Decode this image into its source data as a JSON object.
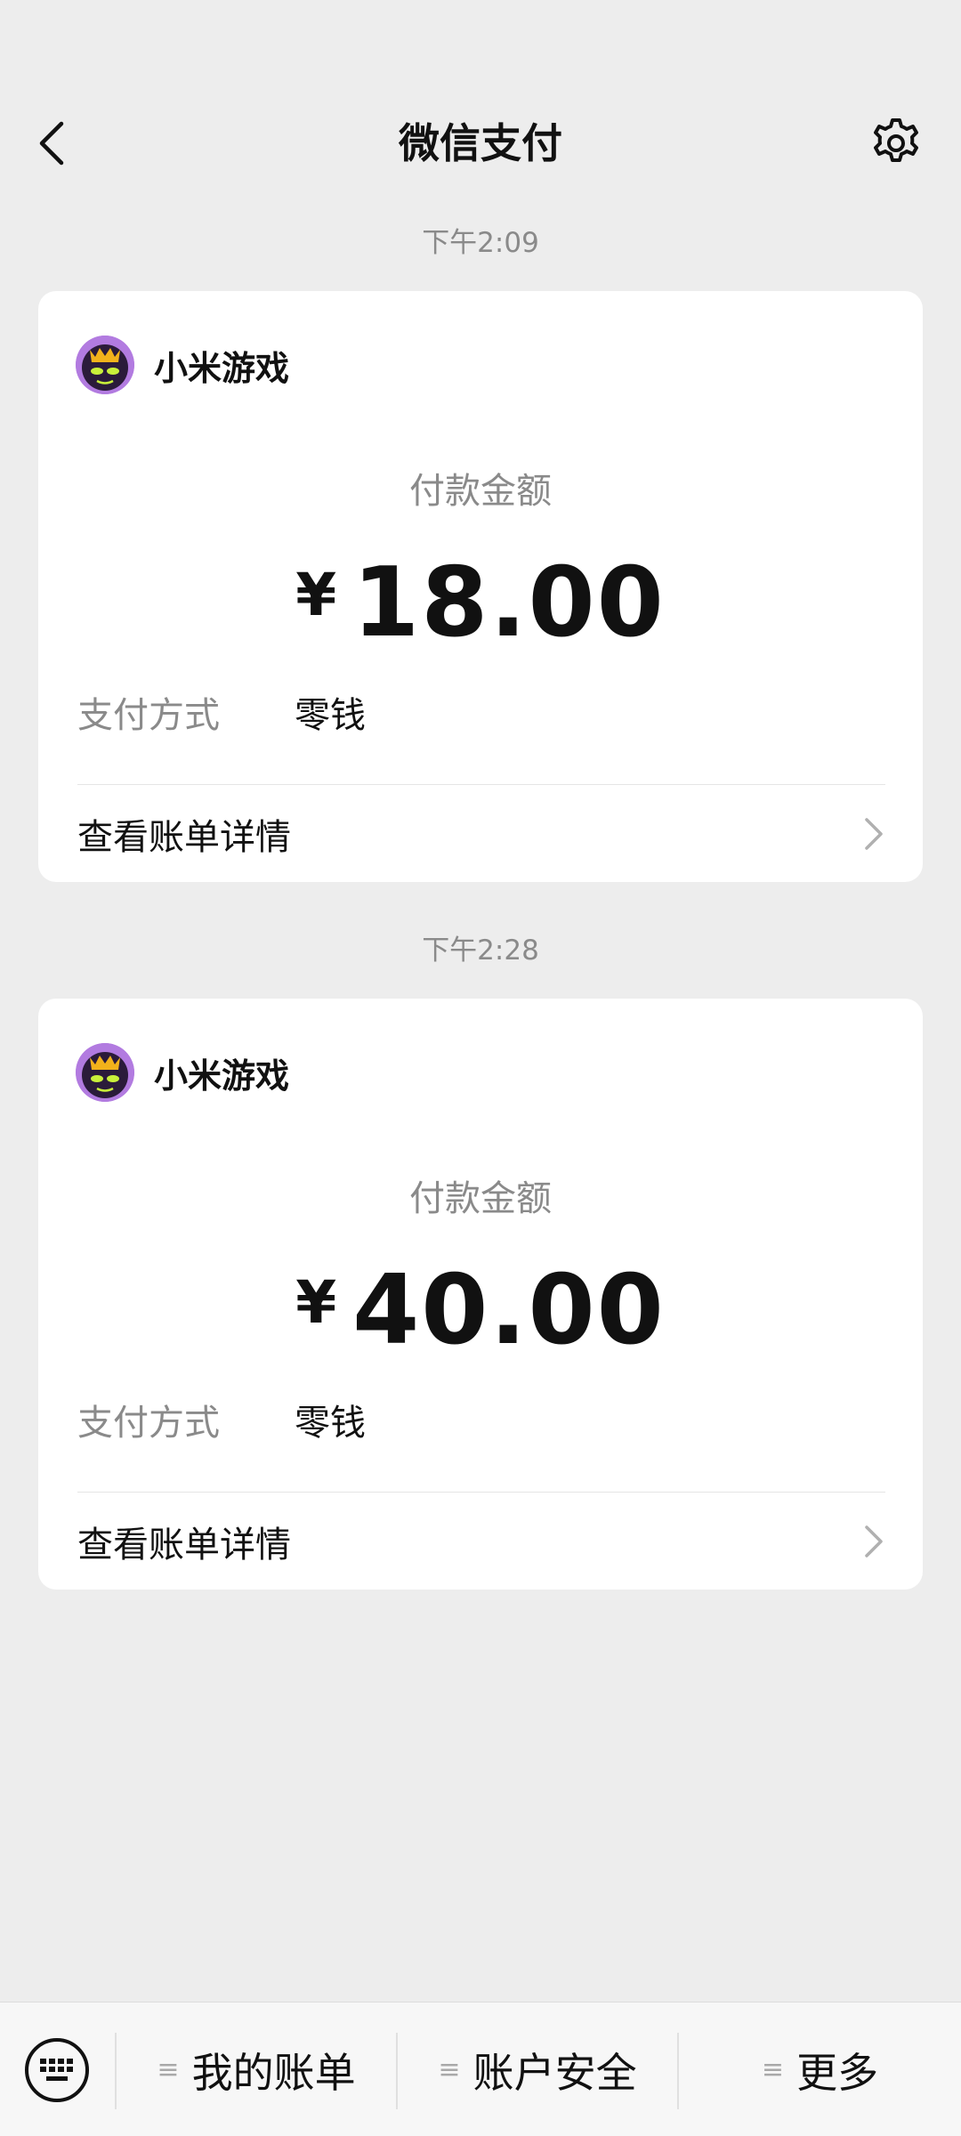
{
  "header": {
    "title": "微信支付",
    "back_icon": "chevron-left-icon",
    "settings_icon": "gear-icon"
  },
  "transactions": [
    {
      "time": "下午2:09",
      "merchant": "小米游戏",
      "amount_label": "付款金额",
      "currency": "¥",
      "amount": "18.00",
      "pay_method_label": "支付方式",
      "pay_method": "零钱",
      "details_label": "查看账单详情"
    },
    {
      "time": "下午2:28",
      "merchant": "小米游戏",
      "amount_label": "付款金额",
      "currency": "¥",
      "amount": "40.00",
      "pay_method_label": "支付方式",
      "pay_method": "零钱",
      "details_label": "查看账单详情"
    }
  ],
  "bottom_bar": {
    "keyboard_icon": "keyboard-icon",
    "menu_icon": "menu-lines-icon",
    "items": [
      {
        "label": "我的账单"
      },
      {
        "label": "账户安全"
      },
      {
        "label": "更多"
      }
    ]
  },
  "colors": {
    "background": "#ededed",
    "card": "#ffffff",
    "muted_text": "#8a8a8a",
    "avatar_accent": "#b27be0"
  }
}
